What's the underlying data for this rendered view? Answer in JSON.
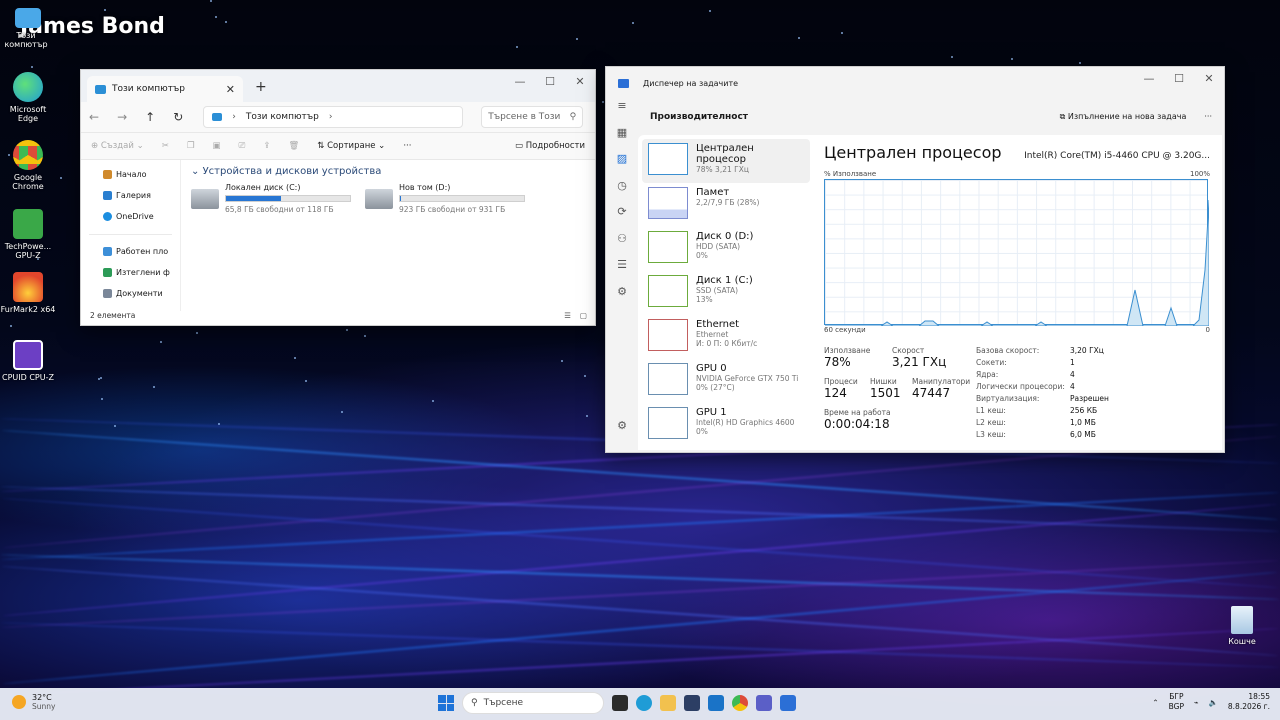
{
  "desktop": {
    "brand": "James Bond",
    "icons": [
      {
        "label": "Този компютър",
        "icon": "computer-icon",
        "color": "#4aa8e8"
      },
      {
        "label": "Microsoft Edge",
        "icon": "edge-icon",
        "color": "#1f9cd6"
      },
      {
        "label": "Google Chrome",
        "icon": "chrome-icon",
        "color": "#dd4b39"
      },
      {
        "label": "TechPowe... GPU-Z",
        "icon": "gpuz-icon",
        "color": "#3aa848"
      },
      {
        "label": "FurMark2 x64",
        "icon": "furmark-icon",
        "color": "#e2462c"
      },
      {
        "label": "CPUID CPU-Z",
        "icon": "cpuz-icon",
        "color": "#6c3fc4"
      },
      {
        "label": "Кошче",
        "icon": "recycle-bin-icon",
        "color": "#bcd8ef"
      }
    ]
  },
  "explorer": {
    "tab_title": "Този компютър",
    "address": "Този компютър",
    "search_placeholder": "Търсене в Този",
    "cmd": {
      "new": "Създай",
      "sort": "Сортиране",
      "more": "···",
      "details": "Подробности"
    },
    "nav": [
      "Начало",
      "Галерия",
      "OneDrive",
      "Работен пло",
      "Изтеглени ф",
      "Документи"
    ],
    "group_header": "Устройства и дискови устройства",
    "drives": [
      {
        "name": "Локален диск (C:)",
        "free": "65,8 ГБ свободни от 118 ГБ",
        "used_fraction": 0.44
      },
      {
        "name": "Нов том (D:)",
        "free": "923 ГБ свободни от 931 ГБ",
        "used_fraction": 0.01
      }
    ],
    "status": "2 елемента"
  },
  "taskmgr": {
    "title": "Диспечер на задачите",
    "section": "Производителност",
    "run_new_task": "Изпълнение на нова задача",
    "more": "···",
    "items": [
      {
        "t1": "Централен процесор",
        "t2": "78% 3,21 ГХц",
        "t3": ""
      },
      {
        "t1": "Памет",
        "t2": "2,2/7,9 ГБ (28%)",
        "t3": ""
      },
      {
        "t1": "Диск 0 (D:)",
        "t2": "HDD (SATA)",
        "t3": "0%"
      },
      {
        "t1": "Диск 1 (C:)",
        "t2": "SSD (SATA)",
        "t3": "13%"
      },
      {
        "t1": "Ethernet",
        "t2": "Ethernet",
        "t3": "И: 0 П: 0 Кбит/с"
      },
      {
        "t1": "GPU 0",
        "t2": "NVIDIA GeForce GTX 750 Ti",
        "t3": "0% (27°C)"
      },
      {
        "t1": "GPU 1",
        "t2": "Intel(R) HD Graphics 4600",
        "t3": "0%"
      }
    ],
    "detail": {
      "title": "Централен процесор",
      "model": "Intel(R) Core(TM) i5-4460 CPU @ 3.20G...",
      "graph_top_left": "% Използване",
      "graph_top_right": "100%",
      "graph_bottom_left": "60 секунди",
      "graph_bottom_right": "0",
      "usage_lbl": "Използване",
      "usage_val": "78%",
      "speed_lbl": "Скорост",
      "speed_val": "3,21 ГХц",
      "proc_lbl": "Процеси",
      "proc_val": "124",
      "threads_lbl": "Нишки",
      "threads_val": "1501",
      "handles_lbl": "Манипулатори",
      "handles_val": "47447",
      "uptime_lbl": "Време на работа",
      "uptime_val": "0:00:04:18",
      "props": [
        {
          "k": "Базова скорост:",
          "v": "3,20 ГХц"
        },
        {
          "k": "Сокети:",
          "v": "1"
        },
        {
          "k": "Ядра:",
          "v": "4"
        },
        {
          "k": "Логически процесори:",
          "v": "4"
        },
        {
          "k": "Виртуализация:",
          "v": "Разрешен"
        },
        {
          "k": "L1 кеш:",
          "v": "256 КБ"
        },
        {
          "k": "L2 кеш:",
          "v": "1,0 МБ"
        },
        {
          "k": "L3 кеш:",
          "v": "6,0 МБ"
        }
      ]
    }
  },
  "taskbar": {
    "temp": "32°C",
    "weather": "Sunny",
    "search": "Търсене",
    "lang1": "БГР",
    "lang2": "BGP",
    "time": "18:55",
    "date": "8.8.2026 г."
  }
}
